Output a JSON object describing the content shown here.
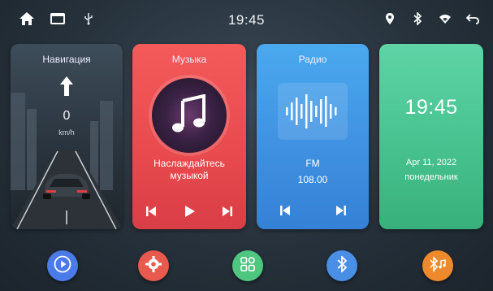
{
  "statusbar": {
    "time": "19:45",
    "left_icons": [
      "home-icon",
      "window-icon",
      "usb-icon"
    ],
    "right_icons": [
      "location-pin-icon",
      "bluetooth-icon",
      "wifi-icon",
      "back-icon"
    ]
  },
  "cards": {
    "navigation": {
      "title": "Навигация",
      "speed": "0",
      "unit": "km/h"
    },
    "music": {
      "title": "Музыка",
      "message_line1": "Наслаждайтесь",
      "message_line2": "музыкой"
    },
    "radio": {
      "title": "Радио",
      "band": "FM",
      "frequency": "108.00"
    },
    "clock": {
      "time": "19:45",
      "date": "Apr 11, 2022",
      "weekday": "понедельник"
    }
  },
  "dock": {
    "items": [
      {
        "icon": "play-icon",
        "color": "#4a7be8"
      },
      {
        "icon": "settings-gear-icon",
        "color": "#e85a4e"
      },
      {
        "icon": "apps-grid-icon",
        "color": "#4fc67f"
      },
      {
        "icon": "bluetooth-icon",
        "color": "#4a8fe6"
      },
      {
        "icon": "bluetooth-music-icon",
        "color": "#ee8a2c"
      }
    ]
  },
  "colors": {
    "music_card": "#e84a4e",
    "radio_card": "#3f8fe0",
    "clock_card": "#47c28f"
  }
}
